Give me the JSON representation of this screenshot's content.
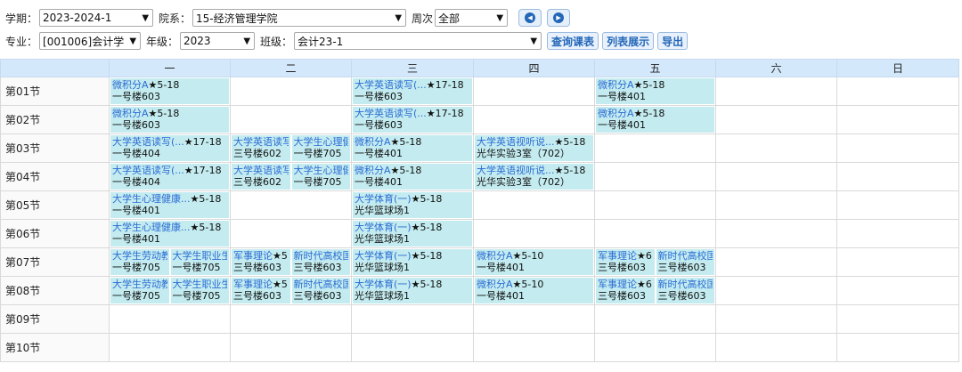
{
  "filters": {
    "term": {
      "label": "学期：",
      "value": "2023-2024-1"
    },
    "dept": {
      "label": "院系：",
      "value": "15-经济管理学院"
    },
    "week": {
      "label": "周次",
      "value": "全部"
    },
    "major": {
      "label": "专业：",
      "value": "[001006]会计学"
    },
    "grade": {
      "label": "年级：",
      "value": "2023"
    },
    "cls": {
      "label": "班级：",
      "value": "会计23-1"
    },
    "buttons": {
      "query": "查询课表",
      "list": "列表展示",
      "export": "导出"
    }
  },
  "table": {
    "days": [
      "一",
      "二",
      "三",
      "四",
      "五",
      "六",
      "日"
    ],
    "periods": [
      "第01节",
      "第02节",
      "第03节",
      "第04节",
      "第05节",
      "第06节",
      "第07节",
      "第08节",
      "第09节",
      "第10节"
    ],
    "rows": [
      [
        [
          {
            "name": "微积分A",
            "weeks": "★5-18",
            "room": "一号楼603"
          }
        ],
        [],
        [
          {
            "name": "大学英语读写(...",
            "weeks": "★17-18",
            "room": "一号楼603"
          }
        ],
        [],
        [
          {
            "name": "微积分A",
            "weeks": "★5-18",
            "room": "一号楼401"
          }
        ],
        [],
        []
      ],
      [
        [
          {
            "name": "微积分A",
            "weeks": "★5-18",
            "room": "一号楼603"
          }
        ],
        [],
        [
          {
            "name": "大学英语读写(...",
            "weeks": "★17-18",
            "room": "一号楼603"
          }
        ],
        [],
        [
          {
            "name": "微积分A",
            "weeks": "★5-18",
            "room": "一号楼401"
          }
        ],
        [],
        []
      ],
      [
        [
          {
            "name": "大学英语读写(...",
            "weeks": "★17-18",
            "room": "一号楼404"
          }
        ],
        [
          {
            "name": "大学英语读写",
            "weeks": "",
            "room": "三号楼602"
          },
          {
            "name": "大学生心理健",
            "weeks": "",
            "room": "一号楼705"
          }
        ],
        [
          {
            "name": "微积分A",
            "weeks": "★5-18",
            "room": "一号楼401"
          }
        ],
        [
          {
            "name": "大学英语视听说...",
            "weeks": "★5-18",
            "room": "光华实验3室（702）"
          }
        ],
        [],
        [],
        []
      ],
      [
        [
          {
            "name": "大学英语读写(...",
            "weeks": "★17-18",
            "room": "一号楼404"
          }
        ],
        [
          {
            "name": "大学英语读写",
            "weeks": "",
            "room": "三号楼602"
          },
          {
            "name": "大学生心理健",
            "weeks": "",
            "room": "一号楼705"
          }
        ],
        [
          {
            "name": "微积分A",
            "weeks": "★5-18",
            "room": "一号楼401"
          }
        ],
        [
          {
            "name": "大学英语视听说...",
            "weeks": "★5-18",
            "room": "光华实验3室（702）"
          }
        ],
        [],
        [],
        []
      ],
      [
        [
          {
            "name": "大学生心理健康...",
            "weeks": "★5-18",
            "room": "一号楼401"
          }
        ],
        [],
        [
          {
            "name": "大学体育(一)",
            "weeks": "★5-18",
            "room": "光华篮球场1"
          }
        ],
        [],
        [],
        [],
        []
      ],
      [
        [
          {
            "name": "大学生心理健康...",
            "weeks": "★5-18",
            "room": "一号楼401"
          }
        ],
        [],
        [
          {
            "name": "大学体育(一)",
            "weeks": "★5-18",
            "room": "光华篮球场1"
          }
        ],
        [],
        [],
        [],
        []
      ],
      [
        [
          {
            "name": "大学生劳动教",
            "weeks": "",
            "room": "一号楼705"
          },
          {
            "name": "大学生职业生",
            "weeks": "",
            "room": "一号楼705"
          }
        ],
        [
          {
            "name": "军事理论",
            "weeks": "★5",
            "room": "三号楼603"
          },
          {
            "name": "新时代高校国",
            "weeks": "",
            "room": "三号楼603"
          }
        ],
        [
          {
            "name": "大学体育(一)",
            "weeks": "★5-18",
            "room": "光华篮球场1"
          }
        ],
        [
          {
            "name": "微积分A",
            "weeks": "★5-10",
            "room": "一号楼401"
          }
        ],
        [
          {
            "name": "军事理论",
            "weeks": "★6",
            "room": "三号楼603"
          },
          {
            "name": "新时代高校国",
            "weeks": "",
            "room": "三号楼603"
          }
        ],
        [],
        []
      ],
      [
        [
          {
            "name": "大学生劳动教",
            "weeks": "",
            "room": "一号楼705"
          },
          {
            "name": "大学生职业生",
            "weeks": "",
            "room": "一号楼705"
          }
        ],
        [
          {
            "name": "军事理论",
            "weeks": "★5",
            "room": "三号楼603"
          },
          {
            "name": "新时代高校国",
            "weeks": "",
            "room": "三号楼603"
          }
        ],
        [
          {
            "name": "大学体育(一)",
            "weeks": "★5-18",
            "room": "光华篮球场1"
          }
        ],
        [
          {
            "name": "微积分A",
            "weeks": "★5-10",
            "room": "一号楼401"
          }
        ],
        [
          {
            "name": "军事理论",
            "weeks": "★6",
            "room": "三号楼603"
          },
          {
            "name": "新时代高校国",
            "weeks": "",
            "room": "三号楼603"
          }
        ],
        [],
        []
      ],
      [
        [],
        [],
        [],
        [],
        [],
        [],
        []
      ],
      [
        [],
        [],
        [],
        [],
        [],
        [],
        []
      ]
    ]
  },
  "colors": {
    "header_bg": "#d4e8fc",
    "course_bg": "#c4ecf0",
    "link": "#2a6bd4"
  }
}
